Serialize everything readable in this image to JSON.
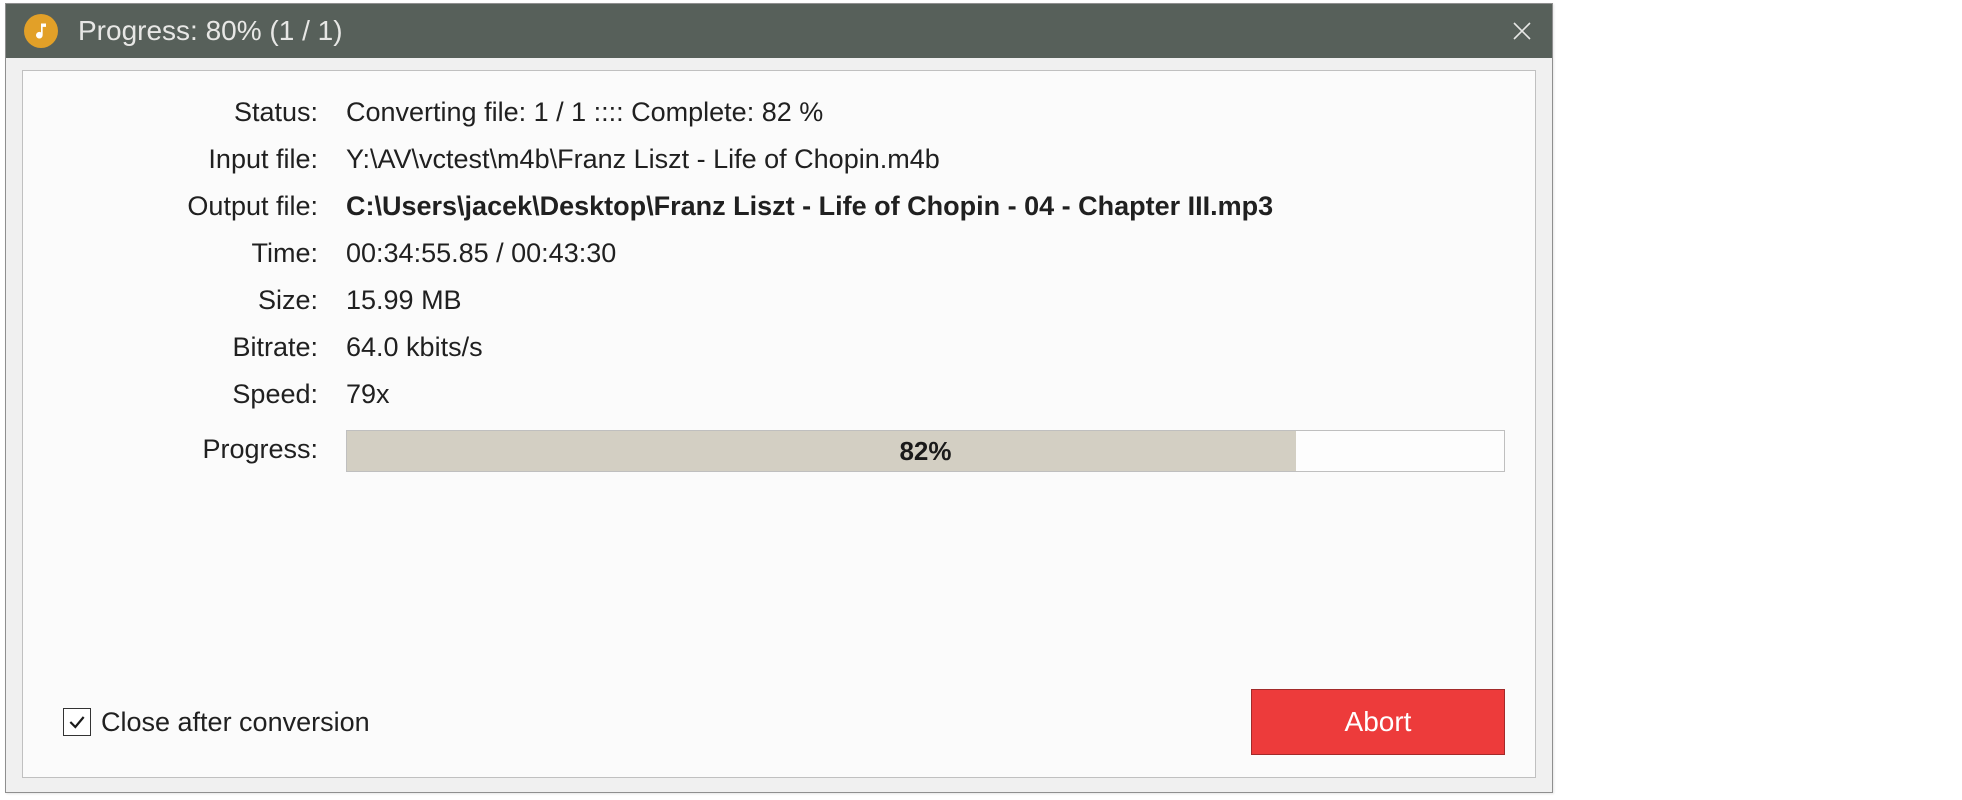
{
  "titlebar": {
    "title": "Progress: 80% (1 / 1)"
  },
  "labels": {
    "status": "Status:",
    "input_file": "Input file:",
    "output_file": "Output file:",
    "time": "Time:",
    "size": "Size:",
    "bitrate": "Bitrate:",
    "speed": "Speed:",
    "progress": "Progress:"
  },
  "values": {
    "status": "Converting file: 1 / 1  ::::  Complete: 82 %",
    "input_file": "Y:\\AV\\vctest\\m4b\\Franz Liszt - Life of Chopin.m4b",
    "output_file": "C:\\Users\\jacek\\Desktop\\Franz Liszt - Life of Chopin - 04 - Chapter III.mp3",
    "time": "00:34:55.85 / 00:43:30",
    "size": "15.99 MB",
    "bitrate": "64.0 kbits/s",
    "speed": "79x"
  },
  "progress": {
    "percent": 82,
    "text": "82%"
  },
  "footer": {
    "close_after_label": "Close after conversion",
    "close_after_checked": true,
    "abort_label": "Abort"
  }
}
